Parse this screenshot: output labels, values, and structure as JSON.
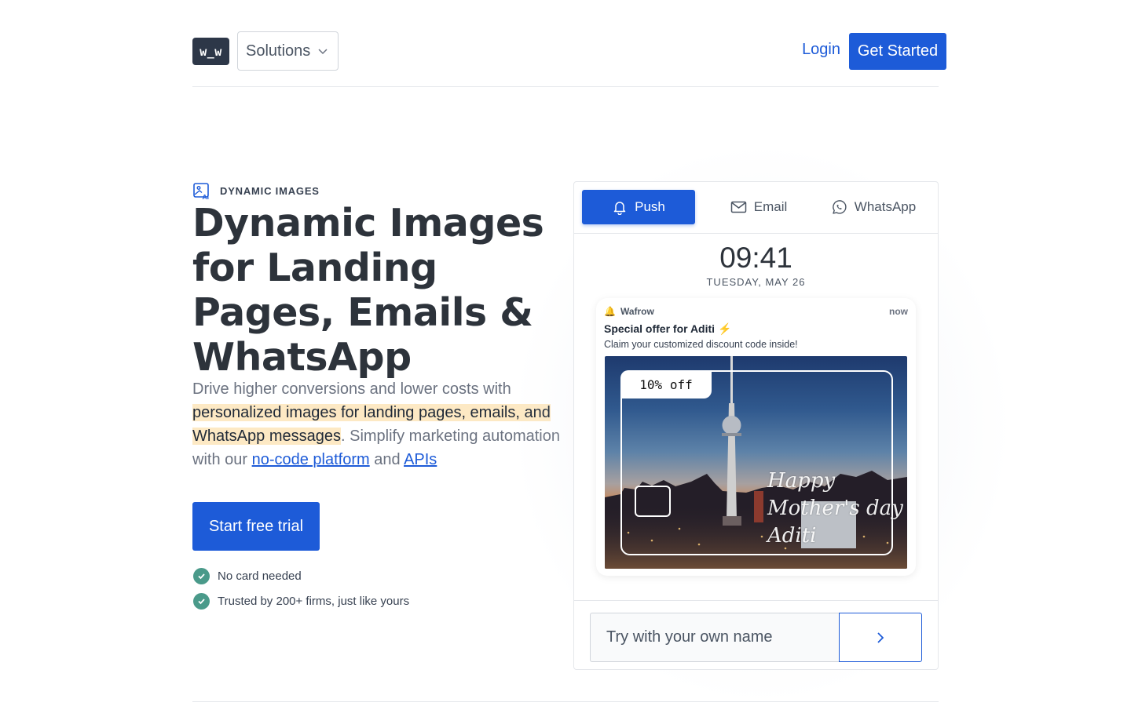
{
  "header": {
    "logo_text": "w_w",
    "solutions_label": "Solutions",
    "login_label": "Login",
    "get_started_label": "Get Started"
  },
  "hero": {
    "eyebrow": "DYNAMIC IMAGES",
    "title": "Dynamic Images for Landing Pages, Emails & WhatsApp",
    "desc_part1": "Drive higher conversions and lower costs with ",
    "desc_highlight": "personalized images for landing pages, emails, and WhatsApp messages",
    "desc_part2": ". Simplify marketing automation with our ",
    "link_nocode": "no-code platform",
    "desc_and": " and ",
    "link_apis": "APIs",
    "cta_label": "Start free trial",
    "checks": [
      "No card needed",
      "Trusted by 200+ firms, just like yours"
    ]
  },
  "preview": {
    "tabs": [
      {
        "label": "Push",
        "icon": "bell-icon",
        "active": true
      },
      {
        "label": "Email",
        "icon": "mail-icon",
        "active": false
      },
      {
        "label": "WhatsApp",
        "icon": "whatsapp-icon",
        "active": false
      }
    ],
    "clock": "09:41",
    "date": "TUESDAY, MAY 26",
    "notification": {
      "app_icon": "🔔",
      "app_name": "Wafrow",
      "time": "now",
      "title": "Special offer for Aditi ⚡",
      "body": "Claim your customized discount code inside!",
      "offer": "10% off",
      "greeting_line1": "Happy",
      "greeting_line2": "Mother's day",
      "greeting_line3": "Aditi"
    },
    "try_placeholder": "Try with your own name"
  },
  "colors": {
    "primary": "#1d5bd8",
    "heading": "#2d333b",
    "check": "#4a9a8a",
    "highlight": "#fde9c4"
  }
}
